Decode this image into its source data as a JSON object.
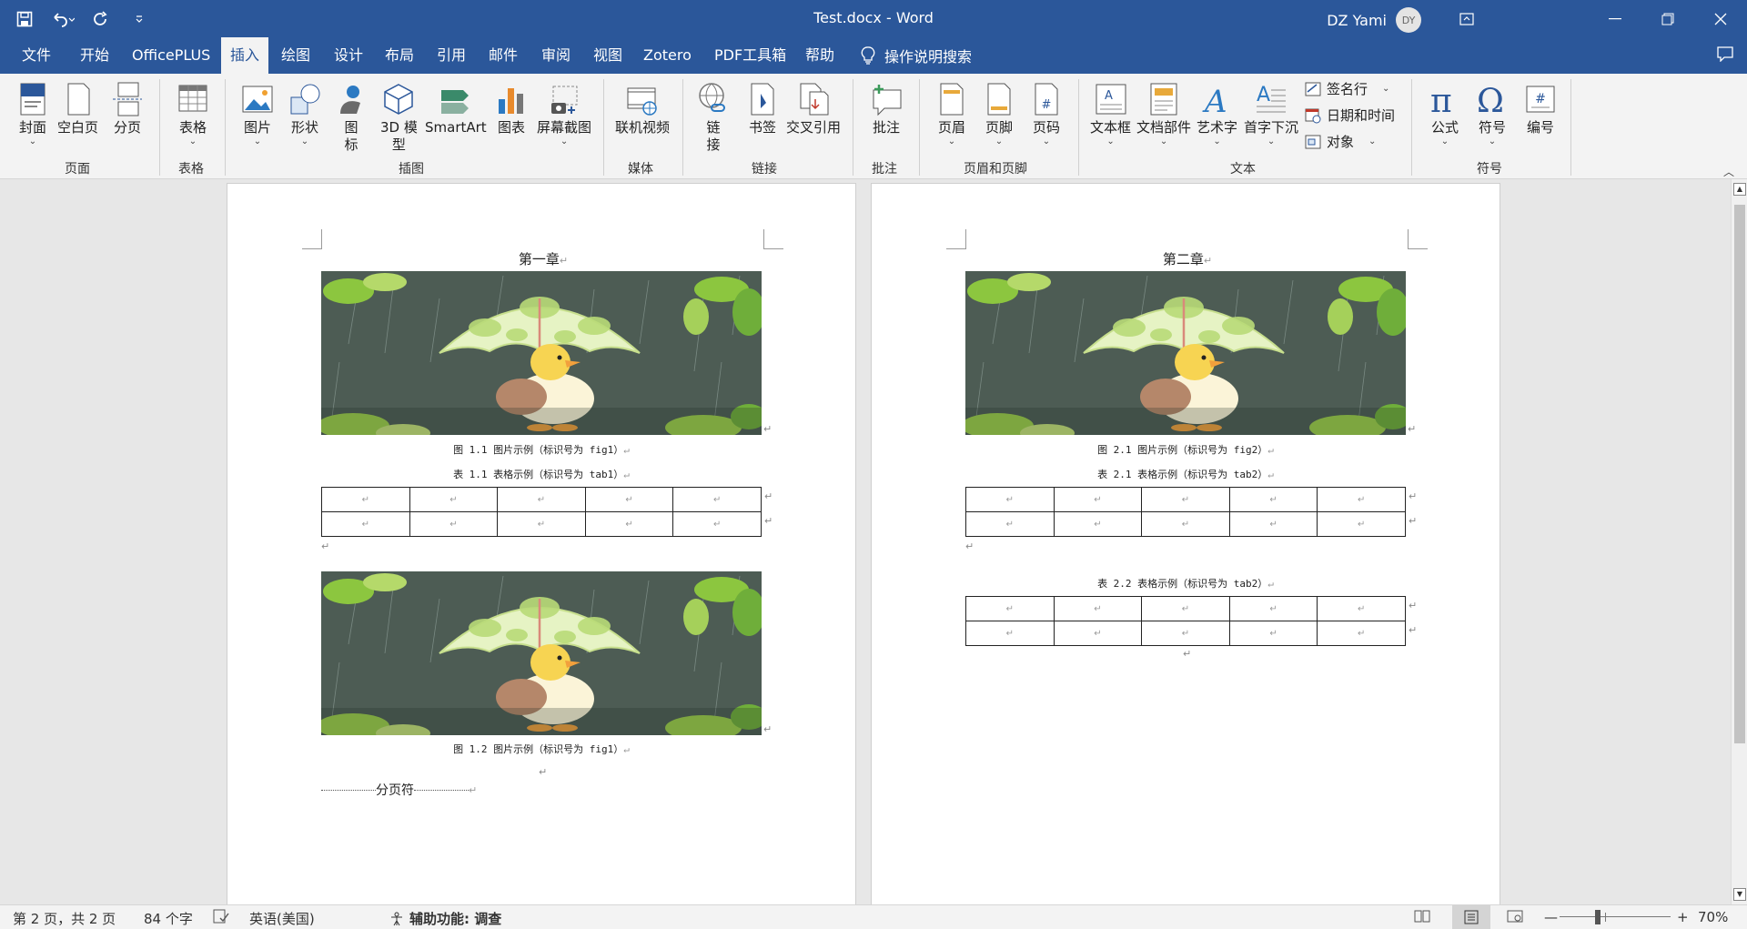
{
  "window": {
    "doc_title": "Test.docx  -  Word",
    "user_name": "DZ Yami",
    "user_initials": "DY"
  },
  "tabs": [
    "文件",
    "开始",
    "OfficePLUS",
    "插入",
    "绘图",
    "设计",
    "布局",
    "引用",
    "邮件",
    "审阅",
    "视图",
    "Zotero",
    "PDF工具箱",
    "帮助"
  ],
  "active_tab": "插入",
  "tell_me": "操作说明搜索",
  "ribbon": {
    "groups": {
      "pages": "页面",
      "tables": "表格",
      "illustrations": "插图",
      "media": "媒体",
      "links": "链接",
      "comments": "批注",
      "header_footer": "页眉和页脚",
      "text": "文本",
      "symbols": "符号"
    },
    "buttons": {
      "cover": "封面",
      "blank_page": "空白页",
      "page_break": "分页",
      "table": "表格",
      "picture": "图片",
      "shapes": "形状",
      "icons_l1": "图",
      "icons_l2": "标",
      "model3d_l1": "3D 模",
      "model3d_l2": "型",
      "smartart": "SmartArt",
      "chart": "图表",
      "screenshot": "屏幕截图",
      "online_video": "联机视频",
      "link_l1": "链",
      "link_l2": "接",
      "bookmark": "书签",
      "cross_ref": "交叉引用",
      "comment": "批注",
      "header": "页眉",
      "footer": "页脚",
      "page_number": "页码",
      "textbox": "文本框",
      "quick_parts": "文档部件",
      "wordart": "艺术字",
      "dropcap": "首字下沉",
      "signature_line": "签名行",
      "date_time": "日期和时间",
      "object": "对象",
      "equation": "公式",
      "symbol": "符号",
      "numbering": "编号"
    }
  },
  "pages": [
    {
      "chapter": "第一章",
      "fig_caption_1": "图 1.1  图片示例（标识号为 fig1）",
      "tab_caption_1": "表 1.1  表格示例（标识号为 tab1）",
      "fig_caption_2": "图 1.2  图片示例（标识号为 fig1）",
      "page_break": "分页符"
    },
    {
      "chapter": "第二章",
      "fig_caption_1": "图 2.1  图片示例（标识号为 fig2）",
      "tab_caption_1": "表 2.1  表格示例（标识号为 tab2）",
      "tab_caption_2": "表 2.2  表格示例（标识号为 tab2）"
    }
  ],
  "para_mark": "↵",
  "statusbar": {
    "page_info": "第 2 页，共 2 页",
    "word_count": "84 个字",
    "language": "英语(美国)",
    "accessibility": "辅助功能: 调查",
    "zoom": "70%"
  },
  "colors": {
    "word_blue": "#2b579a",
    "ribbon_bg": "#f3f3f3",
    "canvas_bg": "#e7e7e7"
  }
}
